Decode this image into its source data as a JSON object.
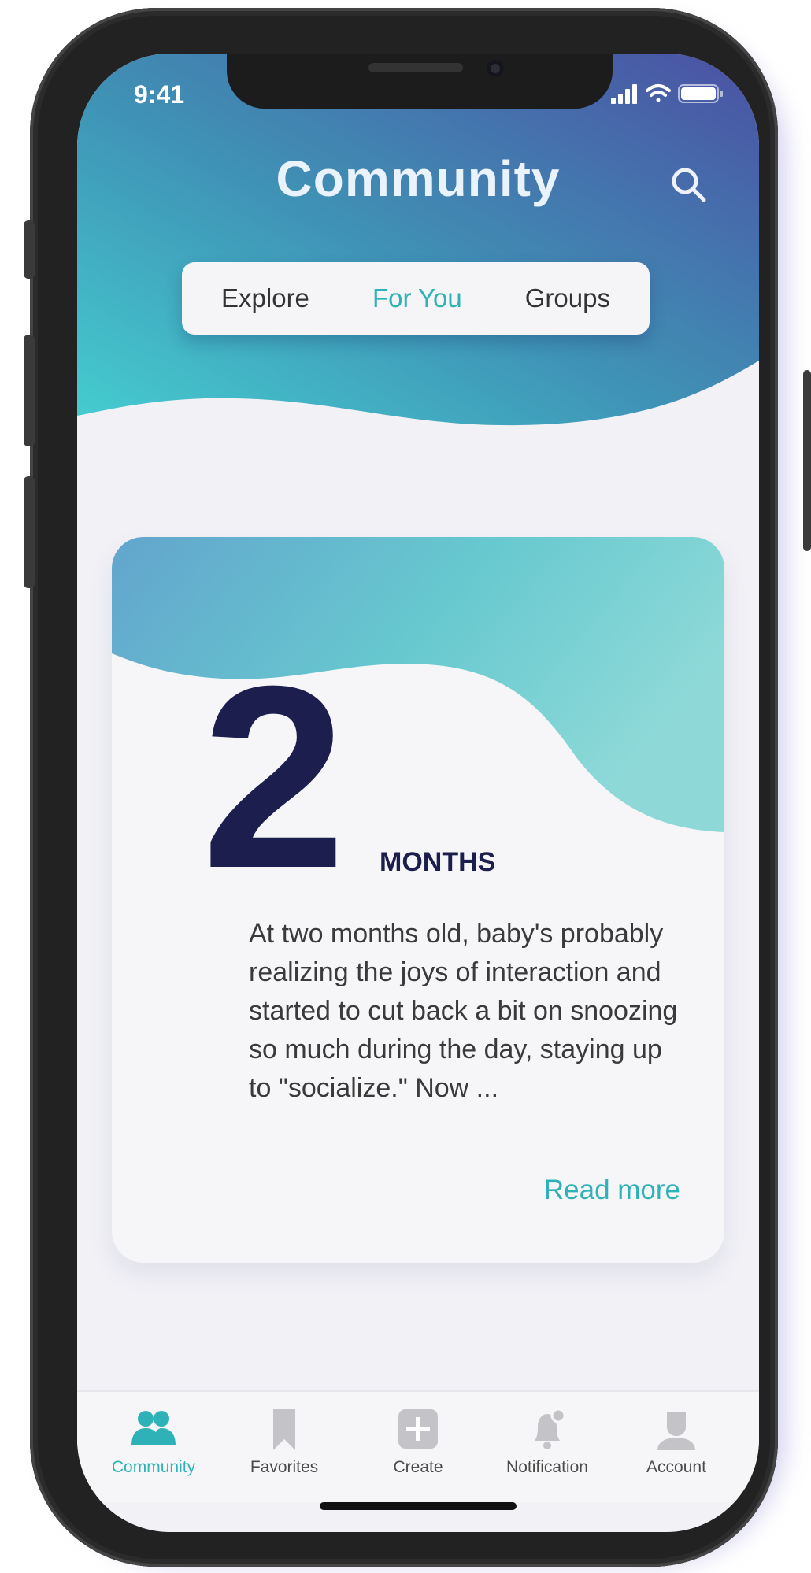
{
  "status_bar": {
    "time": "9:41"
  },
  "header": {
    "title": "Community"
  },
  "tabs": [
    {
      "label": "Explore",
      "active": false
    },
    {
      "label": "For You",
      "active": true
    },
    {
      "label": "Groups",
      "active": false
    }
  ],
  "card": {
    "number": "2",
    "unit": "MONTHS",
    "body": "At two months old, baby's probably realizing the joys of interaction and started to cut back a bit on snoozing so much during the day, staying up to \"socialize.\" Now ...",
    "read_more": "Read more"
  },
  "bottom_nav": [
    {
      "label": "Community",
      "icon": "community-icon",
      "active": true
    },
    {
      "label": "Favorites",
      "icon": "bookmark-icon",
      "active": false
    },
    {
      "label": "Create",
      "icon": "plus-icon",
      "active": false
    },
    {
      "label": "Notification",
      "icon": "bell-icon",
      "active": false
    },
    {
      "label": "Account",
      "icon": "account-icon",
      "active": false
    }
  ],
  "colors": {
    "accent": "#2fb2b7",
    "header_gradient_start": "#49c6cc",
    "header_gradient_end": "#4a59a8",
    "number_color": "#1c1f4d"
  }
}
